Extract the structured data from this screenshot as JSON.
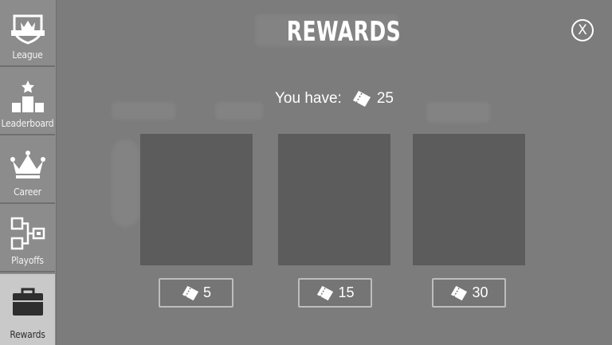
{
  "screen": {
    "title": "REWARDS",
    "close_label": "X"
  },
  "sidebar": {
    "items": [
      {
        "label": "League",
        "icon": "shield-crown-icon",
        "active": false
      },
      {
        "label": "Leaderboard",
        "icon": "podium-icon",
        "active": false
      },
      {
        "label": "Career",
        "icon": "crown-icon",
        "active": false
      },
      {
        "label": "Playoffs",
        "icon": "bracket-icon",
        "active": false
      },
      {
        "label": "Rewards",
        "icon": "briefcase-icon",
        "active": true
      }
    ]
  },
  "balance": {
    "label": "You have:",
    "icon": "ticket-icon",
    "amount": "25"
  },
  "rewards": [
    {
      "cost": "5",
      "icon": "ticket-icon"
    },
    {
      "cost": "15",
      "icon": "ticket-icon"
    },
    {
      "cost": "30",
      "icon": "ticket-icon"
    }
  ],
  "colors": {
    "background": "#7c7c7c",
    "sidebar": "#8c8c8c",
    "active_tab": "#c9c9c9",
    "card": "#5c5c5c",
    "button_border": "#bdbdbd",
    "text": "#ffffff"
  }
}
